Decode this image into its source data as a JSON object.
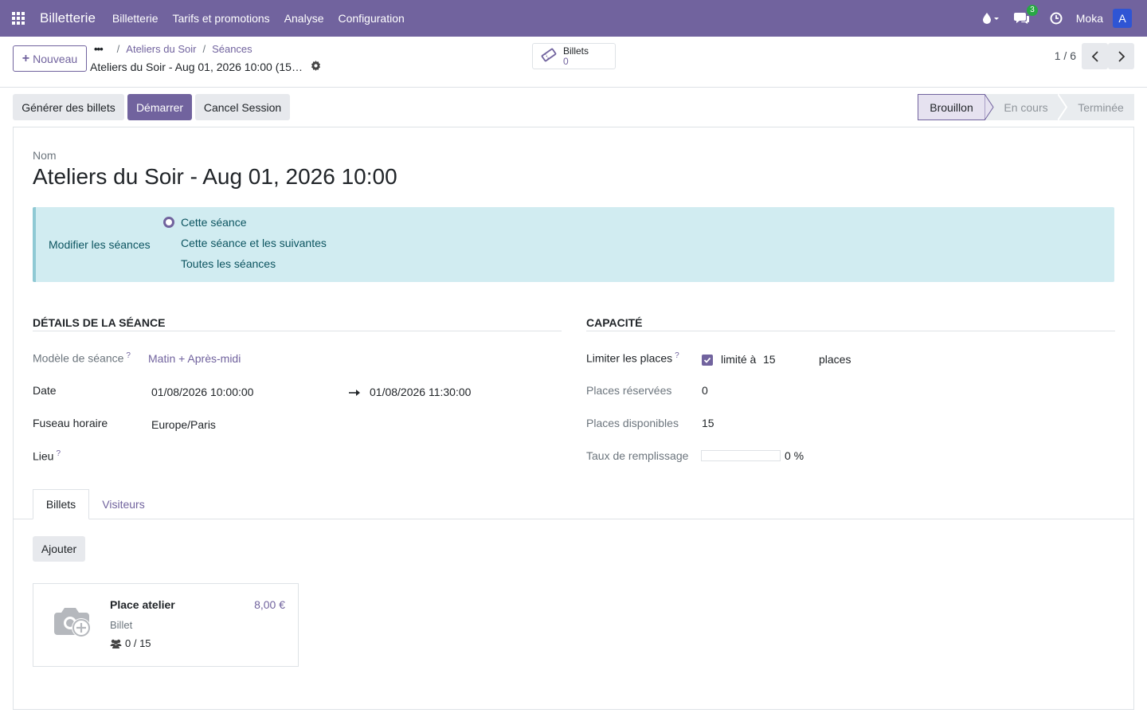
{
  "navbar": {
    "brand": "Billetterie",
    "menu": [
      "Billetterie",
      "Tarifs et promotions",
      "Analyse",
      "Configuration"
    ],
    "messages_count": "3",
    "user_name": "Moka",
    "avatar_letter": "A"
  },
  "control": {
    "new_label": "Nouveau",
    "breadcrumb": [
      "Ateliers du Soir",
      "Séances"
    ],
    "current_record": "Ateliers du Soir - Aug 01, 2026 10:00 (15…",
    "smart_button": {
      "label": "Billets",
      "value": "0"
    },
    "pager": "1 / 6"
  },
  "actions": {
    "generate": "Générer des billets",
    "start": "Démarrer",
    "cancel": "Cancel Session"
  },
  "stages": {
    "draft": "Brouillon",
    "in_progress": "En cours",
    "done": "Terminée",
    "active": "draft"
  },
  "form": {
    "name_label": "Nom",
    "name": "Ateliers du Soir - Aug 01, 2026 10:00",
    "alert": {
      "label": "Modifier les séances",
      "options": [
        "Cette séance",
        "Cette séance et les suivantes",
        "Toutes les séances"
      ],
      "selected": 0
    },
    "details": {
      "title": "Détails de la séance",
      "template_label": "Modèle de séance",
      "template": "Matin + Après-midi",
      "date_label": "Date",
      "date_start": "01/08/2026 10:00:00",
      "date_end": "01/08/2026 11:30:00",
      "tz_label": "Fuseau horaire",
      "tz": "Europe/Paris",
      "venue_label": "Lieu",
      "help_mark": "?"
    },
    "capacity": {
      "title": "Capacité",
      "limit_label": "Limiter les places",
      "limit_checked": true,
      "limited_to": "limité à",
      "max_seats": "15",
      "places": "places",
      "reserved_label": "Places réservées",
      "reserved": "0",
      "available_label": "Places disponibles",
      "available": "15",
      "fill_label": "Taux de remplissage",
      "fill_rate": "0 %",
      "fill_fraction": 0
    },
    "tabs": [
      "Billets",
      "Visiteurs"
    ],
    "add_label": "Ajouter",
    "ticket": {
      "name": "Place atelier",
      "price": "8,00 €",
      "type": "Billet",
      "seats": "0 / 15"
    }
  },
  "colors": {
    "brand": "#71639e",
    "alert_bg": "#d1ecf1",
    "avatar": "#2f55d4",
    "badge": "#28a745"
  }
}
